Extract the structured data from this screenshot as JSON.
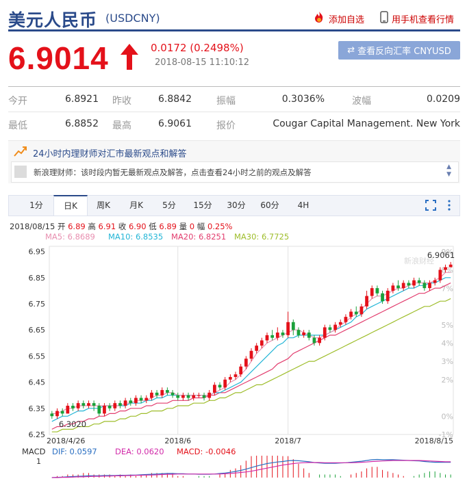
{
  "header": {
    "title": "美元人民币",
    "code": "(USDCNY)",
    "add_watch": "添加自选",
    "mobile_view": "用手机查看行情"
  },
  "quote": {
    "price": "6.9014",
    "change": "0.0172 (0.2498%)",
    "timestamp": "2018-08-15 11:10:12",
    "reverse_button": "查看反向汇率 CNYUSD"
  },
  "stats": {
    "open_label": "今开",
    "open": "6.8921",
    "prev_label": "昨收",
    "prev": "6.8842",
    "amp_label": "振幅",
    "amp": "0.3036%",
    "wave_label": "波幅",
    "wave": "0.0209",
    "low_label": "最低",
    "low": "6.8852",
    "high_label": "最高",
    "high": "6.9061",
    "quoter_label": "报价",
    "quoter": "Cougar Capital Management. New York"
  },
  "qa": {
    "title": "24小时内理财师对汇市最新观点和解答",
    "message": "新浪理财师：该时段内暂无最新观点及解答，点击查看24小时之前的观点及解答"
  },
  "tabs": [
    "1分",
    "日K",
    "周K",
    "月K",
    "5分",
    "15分",
    "30分",
    "60分",
    "4H"
  ],
  "active_tab": "日K",
  "ohlc_line": {
    "date": "2018/08/15",
    "open_label": "开",
    "open": "6.89",
    "high_label": "高",
    "high": "6.91",
    "close_label": "收",
    "close": "6.90",
    "low_label": "低",
    "low": "6.89",
    "vol_label": "量",
    "vol": "0",
    "amp_label": "幅",
    "amp": "0.25%"
  },
  "ma_labels": {
    "ma5": "MA5: 6.8689",
    "ma10": "MA10: 6.8535",
    "ma20": "MA20: 6.8251",
    "ma30": "MA30: 6.7725"
  },
  "macd_labels": {
    "name": "MACD",
    "dif": "DIF: 0.0597",
    "dea": "DEA: 0.0620",
    "macd": "MACD: -0.0046"
  },
  "colors": {
    "up": "#e4111a",
    "down": "#1aa13a",
    "ma5": "#e88fb0",
    "ma10": "#22b5d6",
    "ma20": "#e23d6e",
    "ma30": "#9ebd2a",
    "brand": "#2a4a8a"
  },
  "icons": {
    "add_watch": "flame-icon",
    "mobile": "phone-icon",
    "up_arrow": "arrow-up-icon",
    "reverse": "swap-icon",
    "qa": "trend-icon",
    "fullscreen": "fullscreen-icon",
    "more": "more-vertical-icon"
  },
  "watermark": "新浪财经",
  "chart_data": {
    "type": "candlestick",
    "y_ticks": [
      "6.95",
      "6.85",
      "6.75",
      "6.65",
      "6.55",
      "6.45",
      "6.35",
      "6.25"
    ],
    "pct_ticks": [
      "9%",
      "8%",
      "7%",
      "5%",
      "4%",
      "3%",
      "2%",
      "0%",
      "-1%"
    ],
    "x_labels": [
      "2018/4/26",
      "2018/6",
      "2018/7",
      "2018/8/15"
    ],
    "x_label_index": [
      0,
      24,
      45,
      75
    ],
    "ylim": [
      6.25,
      6.97
    ],
    "max_label": "6.9061",
    "min_label": "6.3020",
    "candles": [
      [
        6.33,
        6.32,
        6.34,
        6.31
      ],
      [
        6.32,
        6.34,
        6.35,
        6.31
      ],
      [
        6.34,
        6.33,
        6.35,
        6.32
      ],
      [
        6.33,
        6.36,
        6.37,
        6.33
      ],
      [
        6.36,
        6.35,
        6.37,
        6.34
      ],
      [
        6.35,
        6.37,
        6.38,
        6.34
      ],
      [
        6.37,
        6.36,
        6.38,
        6.35
      ],
      [
        6.36,
        6.37,
        6.38,
        6.35
      ],
      [
        6.37,
        6.36,
        6.38,
        6.34
      ],
      [
        6.36,
        6.33,
        6.37,
        6.32
      ],
      [
        6.33,
        6.36,
        6.37,
        6.32
      ],
      [
        6.36,
        6.35,
        6.37,
        6.34
      ],
      [
        6.35,
        6.37,
        6.38,
        6.34
      ],
      [
        6.37,
        6.36,
        6.38,
        6.35
      ],
      [
        6.36,
        6.38,
        6.39,
        6.35
      ],
      [
        6.38,
        6.37,
        6.39,
        6.36
      ],
      [
        6.37,
        6.39,
        6.4,
        6.36
      ],
      [
        6.39,
        6.38,
        6.4,
        6.37
      ],
      [
        6.38,
        6.39,
        6.4,
        6.37
      ],
      [
        6.39,
        6.41,
        6.42,
        6.38
      ],
      [
        6.41,
        6.4,
        6.42,
        6.39
      ],
      [
        6.4,
        6.42,
        6.43,
        6.39
      ],
      [
        6.42,
        6.41,
        6.43,
        6.4
      ],
      [
        6.41,
        6.4,
        6.42,
        6.39
      ],
      [
        6.4,
        6.39,
        6.41,
        6.38
      ],
      [
        6.39,
        6.4,
        6.41,
        6.38
      ],
      [
        6.4,
        6.39,
        6.41,
        6.38
      ],
      [
        6.39,
        6.4,
        6.41,
        6.38
      ],
      [
        6.4,
        6.4,
        6.41,
        6.39
      ],
      [
        6.4,
        6.39,
        6.41,
        6.38
      ],
      [
        6.39,
        6.41,
        6.42,
        6.38
      ],
      [
        6.41,
        6.44,
        6.45,
        6.4
      ],
      [
        6.44,
        6.43,
        6.45,
        6.42
      ],
      [
        6.43,
        6.46,
        6.47,
        6.42
      ],
      [
        6.46,
        6.47,
        6.48,
        6.45
      ],
      [
        6.47,
        6.48,
        6.49,
        6.46
      ],
      [
        6.48,
        6.51,
        6.52,
        6.47
      ],
      [
        6.51,
        6.54,
        6.55,
        6.5
      ],
      [
        6.54,
        6.57,
        6.58,
        6.53
      ],
      [
        6.57,
        6.59,
        6.6,
        6.56
      ],
      [
        6.59,
        6.61,
        6.62,
        6.58
      ],
      [
        6.61,
        6.63,
        6.64,
        6.6
      ],
      [
        6.63,
        6.62,
        6.65,
        6.61
      ],
      [
        6.62,
        6.64,
        6.66,
        6.61
      ],
      [
        6.64,
        6.63,
        6.65,
        6.62
      ],
      [
        6.63,
        6.68,
        6.72,
        6.62
      ],
      [
        6.68,
        6.65,
        6.69,
        6.63
      ],
      [
        6.65,
        6.63,
        6.66,
        6.62
      ],
      [
        6.63,
        6.64,
        6.65,
        6.62
      ],
      [
        6.64,
        6.62,
        6.65,
        6.61
      ],
      [
        6.62,
        6.6,
        6.63,
        6.59
      ],
      [
        6.6,
        6.62,
        6.63,
        6.59
      ],
      [
        6.62,
        6.66,
        6.67,
        6.61
      ],
      [
        6.66,
        6.65,
        6.67,
        6.64
      ],
      [
        6.65,
        6.67,
        6.68,
        6.64
      ],
      [
        6.67,
        6.68,
        6.69,
        6.66
      ],
      [
        6.68,
        6.7,
        6.71,
        6.67
      ],
      [
        6.7,
        6.72,
        6.73,
        6.69
      ],
      [
        6.72,
        6.71,
        6.74,
        6.7
      ],
      [
        6.71,
        6.74,
        6.75,
        6.7
      ],
      [
        6.74,
        6.78,
        6.8,
        6.73
      ],
      [
        6.78,
        6.81,
        6.82,
        6.77
      ],
      [
        6.81,
        6.79,
        6.82,
        6.78
      ],
      [
        6.79,
        6.76,
        6.8,
        6.75
      ],
      [
        6.76,
        6.8,
        6.81,
        6.75
      ],
      [
        6.8,
        6.82,
        6.83,
        6.79
      ],
      [
        6.82,
        6.81,
        6.84,
        6.8
      ],
      [
        6.81,
        6.83,
        6.84,
        6.8
      ],
      [
        6.83,
        6.82,
        6.84,
        6.81
      ],
      [
        6.82,
        6.84,
        6.85,
        6.81
      ],
      [
        6.84,
        6.83,
        6.85,
        6.82
      ],
      [
        6.83,
        6.81,
        6.84,
        6.8
      ],
      [
        6.81,
        6.83,
        6.84,
        6.8
      ],
      [
        6.83,
        6.84,
        6.85,
        6.82
      ],
      [
        6.84,
        6.88,
        6.89,
        6.83
      ],
      [
        6.88,
        6.89,
        6.9,
        6.87
      ],
      [
        6.89,
        6.9,
        6.91,
        6.89
      ]
    ],
    "ma": {
      "ma5": [
        6.33,
        6.33,
        6.34,
        6.35,
        6.35,
        6.36,
        6.36,
        6.36,
        6.36,
        6.36,
        6.36,
        6.36,
        6.36,
        6.36,
        6.37,
        6.37,
        6.38,
        6.38,
        6.38,
        6.39,
        6.4,
        6.4,
        6.41,
        6.41,
        6.4,
        6.4,
        6.4,
        6.4,
        6.4,
        6.4,
        6.4,
        6.41,
        6.42,
        6.43,
        6.45,
        6.46,
        6.48,
        6.5,
        6.53,
        6.56,
        6.58,
        6.6,
        6.61,
        6.62,
        6.63,
        6.64,
        6.65,
        6.65,
        6.64,
        6.63,
        6.62,
        6.62,
        6.63,
        6.64,
        6.65,
        6.67,
        6.68,
        6.7,
        6.71,
        6.73,
        6.75,
        6.77,
        6.78,
        6.78,
        6.79,
        6.8,
        6.81,
        6.81,
        6.82,
        6.83,
        6.83,
        6.83,
        6.83,
        6.84,
        6.85,
        6.87,
        6.87
      ],
      "ma10": [
        6.3,
        6.31,
        6.32,
        6.32,
        6.33,
        6.34,
        6.34,
        6.35,
        6.35,
        6.35,
        6.36,
        6.36,
        6.36,
        6.36,
        6.36,
        6.37,
        6.37,
        6.37,
        6.38,
        6.38,
        6.39,
        6.39,
        6.4,
        6.4,
        6.4,
        6.4,
        6.4,
        6.4,
        6.4,
        6.4,
        6.4,
        6.41,
        6.41,
        6.42,
        6.43,
        6.44,
        6.45,
        6.47,
        6.49,
        6.51,
        6.53,
        6.55,
        6.57,
        6.59,
        6.6,
        6.62,
        6.62,
        6.63,
        6.63,
        6.63,
        6.63,
        6.63,
        6.63,
        6.64,
        6.65,
        6.66,
        6.67,
        6.68,
        6.7,
        6.71,
        6.73,
        6.74,
        6.75,
        6.76,
        6.77,
        6.78,
        6.79,
        6.8,
        6.81,
        6.81,
        6.82,
        6.82,
        6.83,
        6.83,
        6.84,
        6.85,
        6.85
      ],
      "ma20": [
        6.27,
        6.28,
        6.28,
        6.29,
        6.29,
        6.3,
        6.3,
        6.31,
        6.31,
        6.32,
        6.32,
        6.33,
        6.33,
        6.34,
        6.34,
        6.35,
        6.35,
        6.35,
        6.36,
        6.36,
        6.37,
        6.37,
        6.37,
        6.38,
        6.38,
        6.38,
        6.38,
        6.39,
        6.39,
        6.39,
        6.4,
        6.4,
        6.41,
        6.41,
        6.42,
        6.43,
        6.44,
        6.45,
        6.46,
        6.47,
        6.48,
        6.49,
        6.5,
        6.52,
        6.53,
        6.54,
        6.56,
        6.57,
        6.58,
        6.59,
        6.6,
        6.61,
        6.62,
        6.63,
        6.63,
        6.64,
        6.65,
        6.66,
        6.67,
        6.68,
        6.69,
        6.7,
        6.71,
        6.72,
        6.73,
        6.74,
        6.75,
        6.76,
        6.77,
        6.78,
        6.79,
        6.79,
        6.8,
        6.81,
        6.81,
        6.82,
        6.83
      ],
      "ma30": [
        6.26,
        6.26,
        6.27,
        6.27,
        6.27,
        6.28,
        6.28,
        6.28,
        6.29,
        6.29,
        6.3,
        6.3,
        6.3,
        6.31,
        6.31,
        6.32,
        6.32,
        6.33,
        6.33,
        6.34,
        6.34,
        6.34,
        6.35,
        6.35,
        6.36,
        6.36,
        6.36,
        6.37,
        6.37,
        6.37,
        6.38,
        6.38,
        6.39,
        6.39,
        6.4,
        6.41,
        6.41,
        6.42,
        6.43,
        6.44,
        6.44,
        6.45,
        6.46,
        6.47,
        6.48,
        6.49,
        6.5,
        6.51,
        6.52,
        6.53,
        6.53,
        6.54,
        6.55,
        6.56,
        6.57,
        6.58,
        6.59,
        6.6,
        6.61,
        6.62,
        6.63,
        6.64,
        6.65,
        6.66,
        6.67,
        6.68,
        6.69,
        6.7,
        6.71,
        6.72,
        6.73,
        6.74,
        6.74,
        6.75,
        6.76,
        6.76,
        6.77
      ]
    },
    "macd": {
      "ylabel_tick": "1",
      "dif": [
        0.0,
        0.001,
        0.002,
        0.003,
        0.004,
        0.005,
        0.006,
        0.007,
        0.007,
        0.007,
        0.008,
        0.008,
        0.008,
        0.009,
        0.009,
        0.01,
        0.01,
        0.011,
        0.012,
        0.013,
        0.014,
        0.015,
        0.016,
        0.016,
        0.015,
        0.015,
        0.014,
        0.014,
        0.013,
        0.013,
        0.013,
        0.014,
        0.016,
        0.018,
        0.021,
        0.024,
        0.028,
        0.033,
        0.039,
        0.045,
        0.05,
        0.055,
        0.058,
        0.061,
        0.063,
        0.066,
        0.067,
        0.066,
        0.064,
        0.062,
        0.059,
        0.057,
        0.056,
        0.056,
        0.056,
        0.057,
        0.058,
        0.06,
        0.062,
        0.064,
        0.067,
        0.07,
        0.071,
        0.07,
        0.07,
        0.07,
        0.069,
        0.068,
        0.067,
        0.066,
        0.065,
        0.063,
        0.061,
        0.06,
        0.06,
        0.06,
        0.06
      ],
      "dea": [
        0.0,
        0.0,
        0.001,
        0.001,
        0.002,
        0.003,
        0.003,
        0.004,
        0.005,
        0.005,
        0.006,
        0.006,
        0.007,
        0.007,
        0.008,
        0.008,
        0.009,
        0.009,
        0.01,
        0.01,
        0.011,
        0.012,
        0.013,
        0.013,
        0.014,
        0.014,
        0.014,
        0.014,
        0.014,
        0.014,
        0.014,
        0.014,
        0.014,
        0.015,
        0.016,
        0.018,
        0.02,
        0.022,
        0.025,
        0.029,
        0.033,
        0.037,
        0.041,
        0.045,
        0.049,
        0.052,
        0.055,
        0.057,
        0.058,
        0.059,
        0.059,
        0.059,
        0.058,
        0.058,
        0.058,
        0.058,
        0.058,
        0.058,
        0.059,
        0.06,
        0.061,
        0.063,
        0.064,
        0.065,
        0.066,
        0.067,
        0.067,
        0.067,
        0.067,
        0.067,
        0.067,
        0.066,
        0.065,
        0.064,
        0.063,
        0.062,
        0.062
      ]
    }
  }
}
